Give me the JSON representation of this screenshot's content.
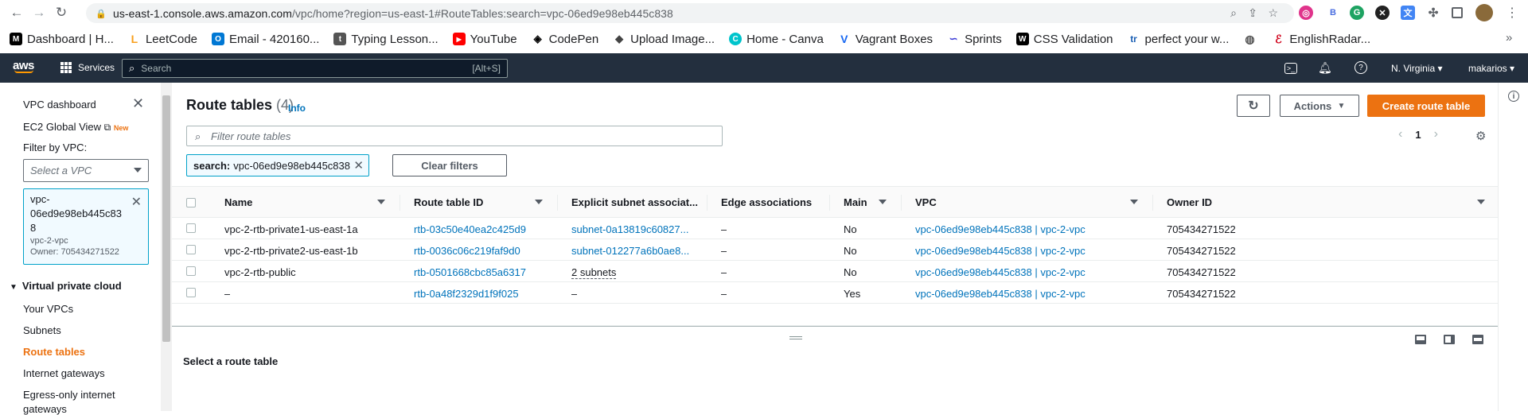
{
  "browser": {
    "url_host": "us-east-1.console.aws.amazon.com",
    "url_path": "/vpc/home?region=us-east-1#RouteTables:search=vpc-06ed9e98eb445c838"
  },
  "bookmarks": [
    {
      "label": "Dashboard | H...",
      "icon": "dashboard-favicon",
      "color": "#000000"
    },
    {
      "label": "LeetCode",
      "icon": "leetcode-favicon",
      "color": "#f89f1b"
    },
    {
      "label": "Email - 420160...",
      "icon": "outlook-favicon",
      "color": "#0078d4"
    },
    {
      "label": "Typing Lesson...",
      "icon": "typing-favicon",
      "color": "#555555"
    },
    {
      "label": "YouTube",
      "icon": "youtube-favicon",
      "color": "#ff0000"
    },
    {
      "label": "CodePen",
      "icon": "codepen-favicon",
      "color": "#000000"
    },
    {
      "label": "Upload Image...",
      "icon": "upload-favicon",
      "color": "#444444"
    },
    {
      "label": "Home - Canva",
      "icon": "canva-favicon",
      "color": "#00c4cc"
    },
    {
      "label": "Vagrant Boxes",
      "icon": "vagrant-favicon",
      "color": "#1868f2"
    },
    {
      "label": "Sprints",
      "icon": "sprints-favicon",
      "color": "#3b3bd6"
    },
    {
      "label": "CSS Validation",
      "icon": "css-favicon",
      "color": "#000000"
    },
    {
      "label": "perfect your w...",
      "icon": "wr-favicon",
      "color": "#1a5fb4"
    },
    {
      "label": "",
      "icon": "globe-favicon",
      "color": "#555555"
    },
    {
      "label": "EnglishRadar...",
      "icon": "englishradar-favicon",
      "color": "#d0021b"
    }
  ],
  "aws_header": {
    "services_label": "Services",
    "search_placeholder": "Search",
    "search_shortcut": "[Alt+S]",
    "region": "N. Virginia",
    "user": "makarios"
  },
  "sidebar": {
    "dashboard": "VPC dashboard",
    "ec2_global": "EC2 Global View",
    "new_badge": "New",
    "filter_label": "Filter by VPC:",
    "select_placeholder": "Select a VPC",
    "selected_vpc": {
      "id_line1": "vpc-",
      "id_line2": "06ed9e98eb445c83",
      "id_line3": "8",
      "name": "vpc-2-vpc",
      "owner": "Owner: 705434271522"
    },
    "section": "Virtual private cloud",
    "items": [
      {
        "label": "Your VPCs"
      },
      {
        "label": "Subnets"
      },
      {
        "label": "Route tables"
      },
      {
        "label": "Internet gateways"
      },
      {
        "label": "Egress-only internet"
      },
      {
        "label": "gateways"
      }
    ]
  },
  "main": {
    "title": "Route tables",
    "count": "(4)",
    "info": "Info",
    "actions": "Actions",
    "create": "Create route table",
    "filter_placeholder": "Filter route tables",
    "token_key": "search:",
    "token_value": "vpc-06ed9e98eb445c838",
    "clear_filters": "Clear filters",
    "page": "1",
    "columns": [
      "Name",
      "Route table ID",
      "Explicit subnet associat...",
      "Edge associations",
      "Main",
      "VPC",
      "Owner ID"
    ],
    "rows": [
      {
        "name": "vpc-2-rtb-private1-us-east-1a",
        "id": "rtb-03c50e40ea2c425d9",
        "subnet": "subnet-0a13819c60827...",
        "edge": "–",
        "main": "No",
        "vpc": "vpc-06ed9e98eb445c838 | vpc-2-vpc",
        "owner": "705434271522"
      },
      {
        "name": "vpc-2-rtb-private2-us-east-1b",
        "id": "rtb-0036c06c219faf9d0",
        "subnet": "subnet-012277a6b0ae8...",
        "edge": "–",
        "main": "No",
        "vpc": "vpc-06ed9e98eb445c838 | vpc-2-vpc",
        "owner": "705434271522"
      },
      {
        "name": "vpc-2-rtb-public",
        "id": "rtb-0501668cbc85a6317",
        "subnet": "2 subnets",
        "edge": "–",
        "main": "No",
        "vpc": "vpc-06ed9e98eb445c838 | vpc-2-vpc",
        "owner": "705434271522"
      },
      {
        "name": "–",
        "id": "rtb-0a48f2329d1f9f025",
        "subnet": "–",
        "edge": "–",
        "main": "Yes",
        "vpc": "vpc-06ed9e98eb445c838 | vpc-2-vpc",
        "owner": "705434271522"
      }
    ],
    "select_prompt": "Select a route table"
  },
  "colors": {
    "accent": "#ec7211",
    "link": "#0073bb",
    "header": "#232f3e"
  }
}
